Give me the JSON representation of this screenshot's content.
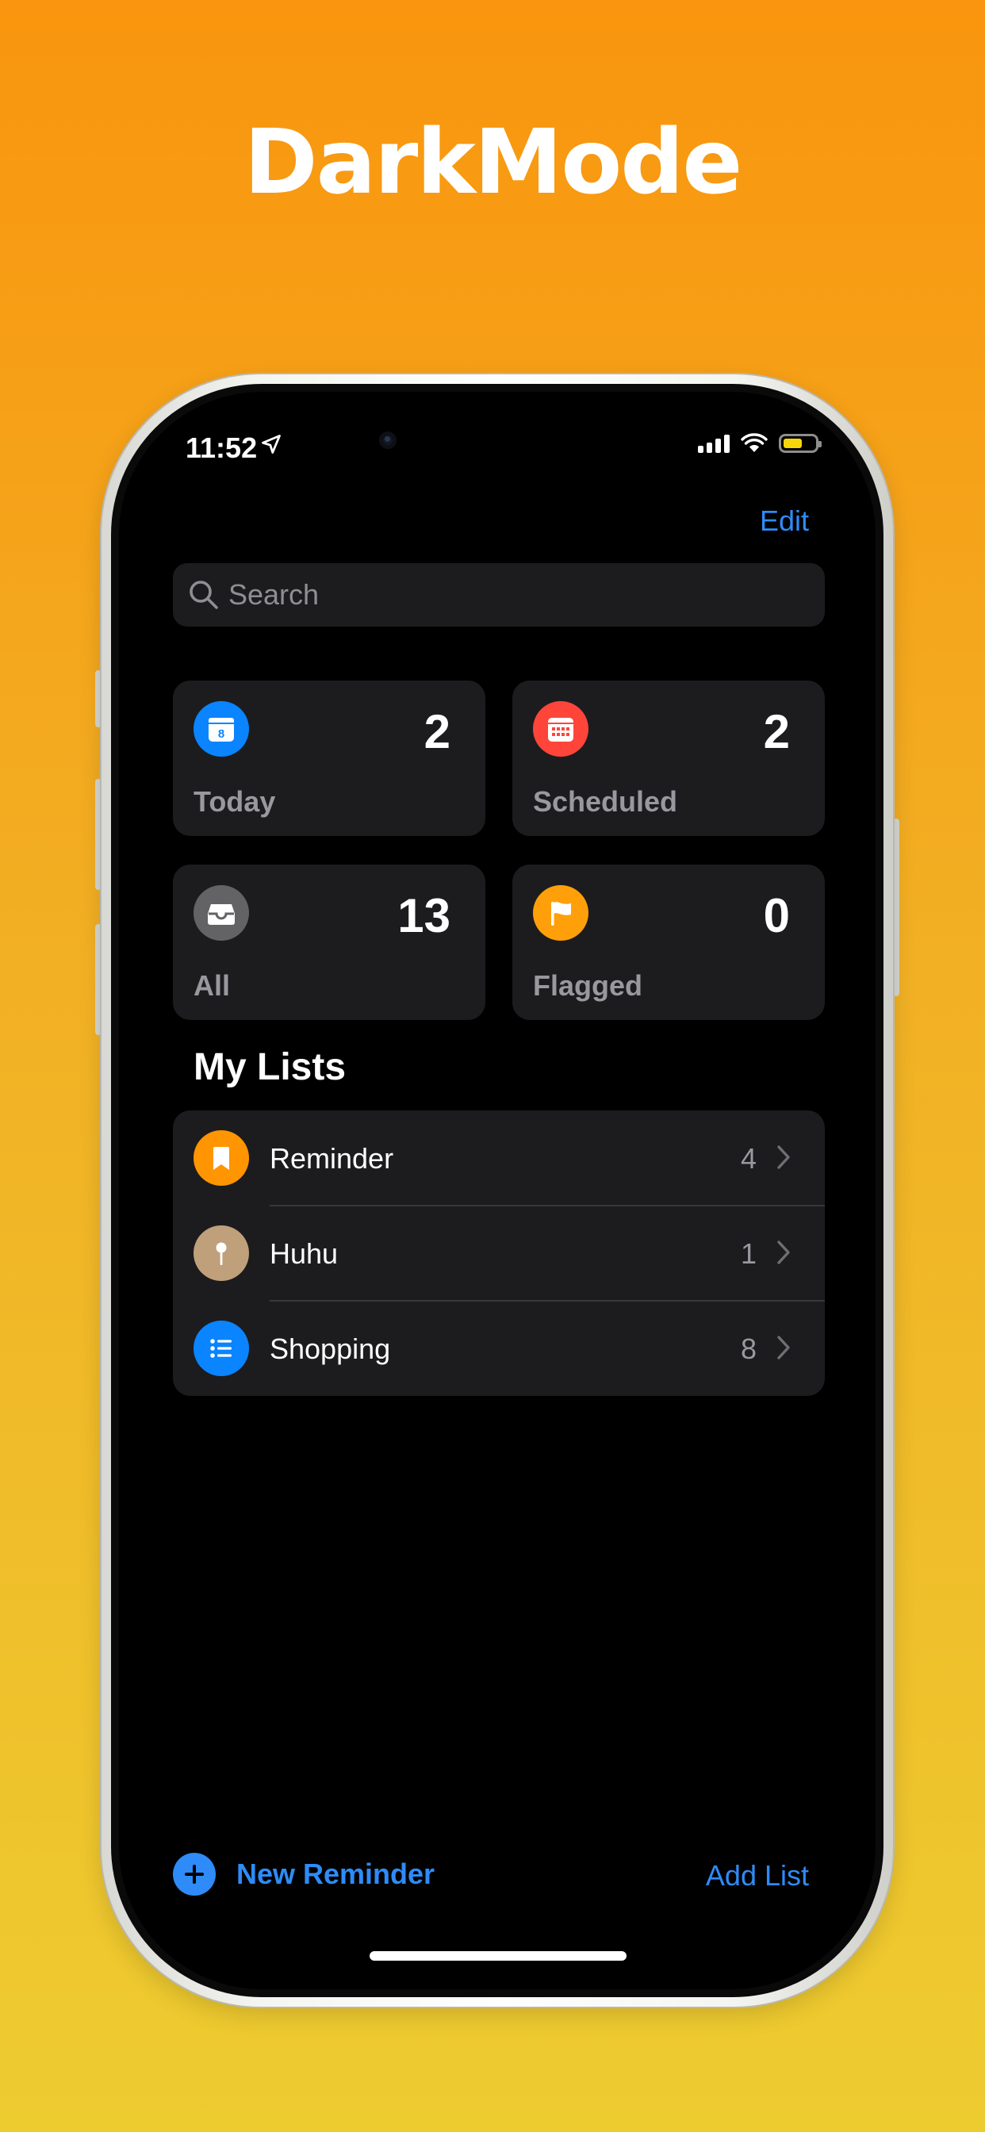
{
  "hero": {
    "title": "DarkMode"
  },
  "status_bar": {
    "time": "11:52",
    "battery_level": 0.6,
    "battery_color": "#F5D60A"
  },
  "header": {
    "edit_label": "Edit"
  },
  "search": {
    "placeholder": "Search"
  },
  "summary_cards": [
    {
      "label": "Today",
      "count": "2",
      "icon": "calendar-today-icon",
      "color": "#0A84FF",
      "day_number": "8"
    },
    {
      "label": "Scheduled",
      "count": "2",
      "icon": "calendar-grid-icon",
      "color": "#FF453A"
    },
    {
      "label": "All",
      "count": "13",
      "icon": "tray-icon",
      "color": "#636366"
    },
    {
      "label": "Flagged",
      "count": "0",
      "icon": "flag-icon",
      "color": "#FF9F0A"
    }
  ],
  "my_lists": {
    "title": "My Lists",
    "items": [
      {
        "name": "Reminder",
        "count": "4",
        "icon": "bookmark-icon",
        "color": "#FF9500"
      },
      {
        "name": "Huhu",
        "count": "1",
        "icon": "pin-icon",
        "color": "#BFA07A"
      },
      {
        "name": "Shopping",
        "count": "8",
        "icon": "list-bullet-icon",
        "color": "#0A84FF"
      }
    ]
  },
  "toolbar": {
    "new_reminder_label": "New Reminder",
    "add_list_label": "Add List",
    "accent": "#2E8BF7"
  }
}
